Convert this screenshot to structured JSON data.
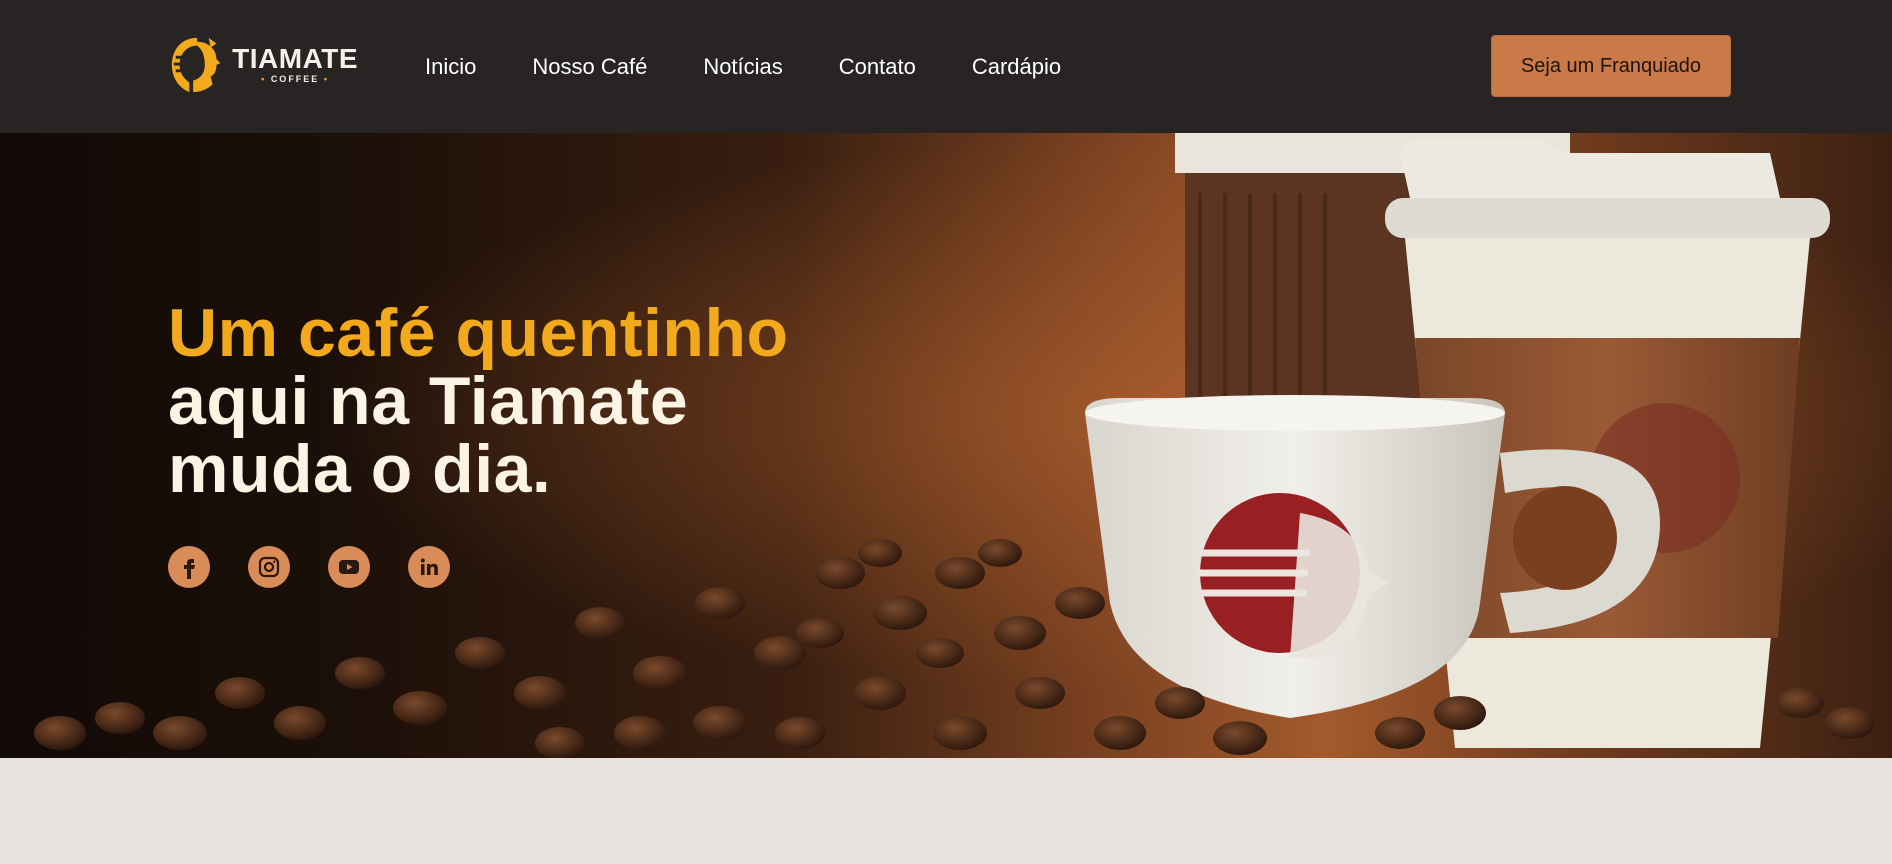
{
  "brand": {
    "name": "TIAMATE",
    "sub": "COFFEE"
  },
  "nav": {
    "items": [
      {
        "label": "Inicio"
      },
      {
        "label": "Nosso Café"
      },
      {
        "label": "Notícias"
      },
      {
        "label": "Contato"
      },
      {
        "label": "Cardápio"
      }
    ]
  },
  "cta": {
    "label": "Seja um Franquiado"
  },
  "hero": {
    "line1": "Um café quentinho",
    "line2": "aqui na Tiamate",
    "line3": "muda o dia."
  },
  "socials": [
    {
      "icon": "facebook-icon"
    },
    {
      "icon": "instagram-icon"
    },
    {
      "icon": "youtube-icon"
    },
    {
      "icon": "linkedin-icon"
    }
  ],
  "colors": {
    "header_bg": "#272423",
    "accent_orange": "#f2a91c",
    "button_copper": "#c97a48",
    "headline_cream": "#fbf3e4",
    "social_bg": "#d98c57"
  }
}
